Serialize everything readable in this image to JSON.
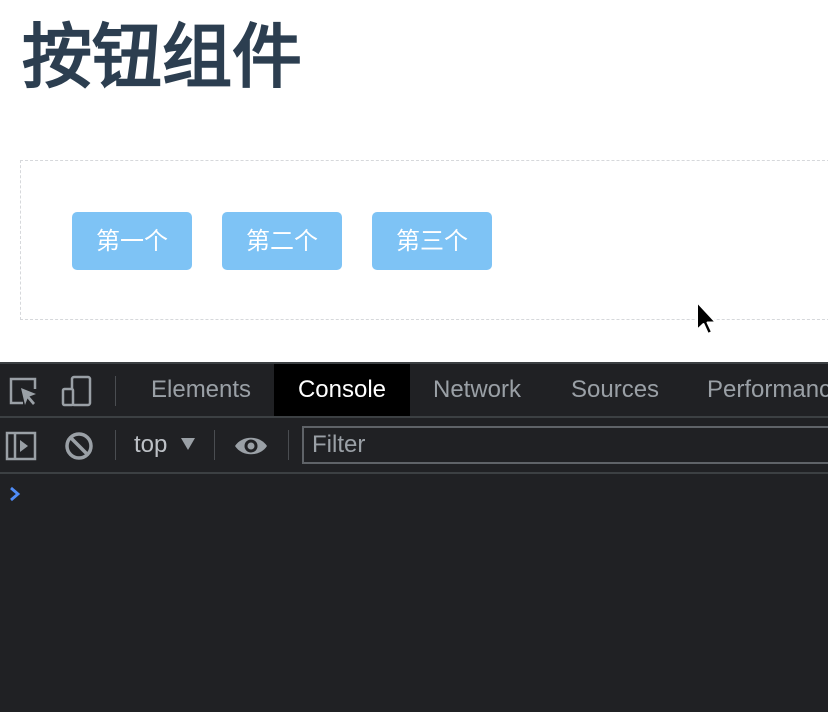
{
  "page": {
    "title": "按钮组件",
    "buttons": [
      "第一个",
      "第二个",
      "第三个"
    ]
  },
  "devtools": {
    "tabs": [
      "Elements",
      "Console",
      "Network",
      "Sources",
      "Performance"
    ],
    "active_tab": "Console",
    "context": "top",
    "filter_placeholder": "Filter"
  },
  "colors": {
    "title": "#2c3e50",
    "button_bg": "#7ec3f5",
    "devtools_bg": "#202124",
    "active_tab_bg": "#000000",
    "prompt": "#4f8cf7"
  },
  "icons": [
    "inspect-element-icon",
    "device-toolbar-icon",
    "sidebar-toggle-icon",
    "clear-console-icon",
    "context-dropdown-icon",
    "eye-icon",
    "cursor-icon",
    "console-prompt-icon"
  ]
}
